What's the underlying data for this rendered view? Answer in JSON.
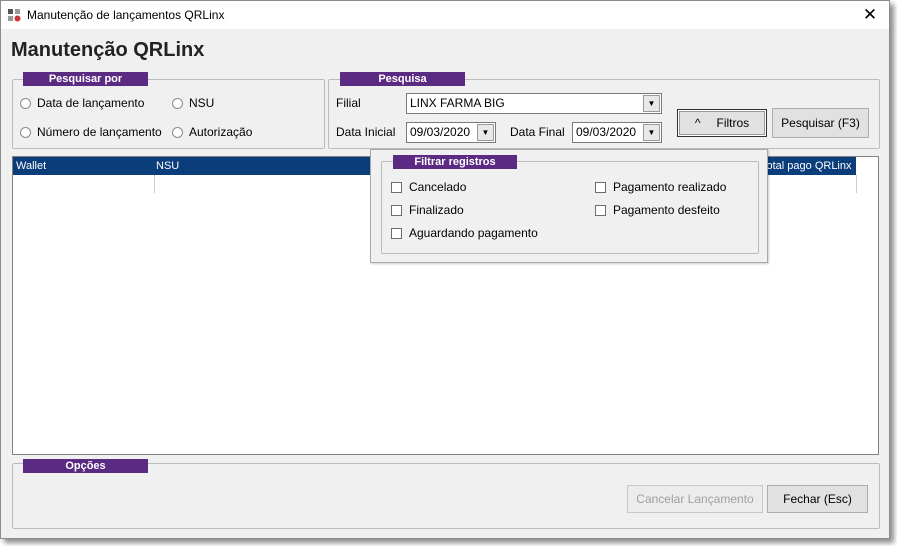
{
  "window": {
    "title": "Manutenção de lançamentos QRLinx",
    "close_glyph": "✕"
  },
  "heading": "Manutenção QRLinx",
  "pesquisar_por": {
    "legend": "Pesquisar por",
    "options": [
      "Data de lançamento",
      "NSU",
      "Número de lançamento",
      "Autorização"
    ]
  },
  "pesquisa": {
    "legend": "Pesquisa",
    "filial_label": "Filial",
    "filial_value": "LINX FARMA BIG",
    "data_inicial_label": "Data Inicial",
    "data_inicial_value": "09/03/2020",
    "data_final_label": "Data Final",
    "data_final_value": "09/03/2020",
    "filtros_label": "Filtros",
    "filtros_glyph": "^",
    "pesquisar_label": "Pesquisar (F3)"
  },
  "grid": {
    "columns": [
      "Wallet",
      "NSU",
      "Total pago QRLinx"
    ]
  },
  "filtrar": {
    "legend": "Filtrar registros",
    "checks": [
      "Cancelado",
      "Pagamento realizado",
      "Finalizado",
      "Pagamento desfeito",
      "Aguardando pagamento"
    ]
  },
  "opcoes": {
    "legend": "Opções",
    "cancelar_label": "Cancelar Lançamento",
    "fechar_label": "Fechar (Esc)"
  },
  "colors": {
    "legend_bg": "#5b2a82",
    "grid_header_bg": "#0a3d7a"
  }
}
